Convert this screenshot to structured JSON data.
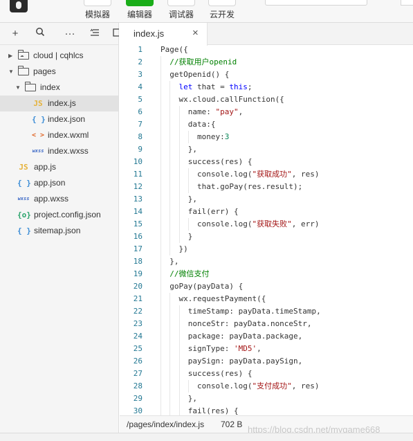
{
  "toolbar": {
    "tools": [
      {
        "label": "模拟器",
        "active": false
      },
      {
        "label": "编辑器",
        "active": true
      },
      {
        "label": "调试器",
        "active": false
      },
      {
        "label": "云开发",
        "active": false
      }
    ],
    "mode_select": "",
    "accent_color": "#1aad19"
  },
  "sidebar": {
    "toolbar_icons": [
      "add-icon",
      "search-icon",
      "more-icon",
      "sort-icon",
      "collapse-icon"
    ],
    "tree": [
      {
        "name": "cloud | cqhlcs",
        "type": "cloud-folder",
        "expanded": false
      },
      {
        "name": "pages",
        "type": "folder",
        "expanded": true
      },
      {
        "name": "index",
        "type": "folder",
        "expanded": true
      },
      {
        "name": "index.js",
        "type": "js",
        "selected": true,
        "icon_text": "JS"
      },
      {
        "name": "index.json",
        "type": "json",
        "icon_text": "{ }"
      },
      {
        "name": "index.wxml",
        "type": "wxml",
        "icon_text": "< >"
      },
      {
        "name": "index.wxss",
        "type": "wxss",
        "icon_text": "wxss"
      },
      {
        "name": "app.js",
        "type": "js",
        "icon_text": "JS"
      },
      {
        "name": "app.json",
        "type": "json",
        "icon_text": "{ }"
      },
      {
        "name": "app.wxss",
        "type": "wxss",
        "icon_text": "wxss"
      },
      {
        "name": "project.config.json",
        "type": "config",
        "icon_text": "{o}"
      },
      {
        "name": "sitemap.json",
        "type": "json",
        "icon_text": "{ }"
      }
    ]
  },
  "editor": {
    "tab": {
      "name": "index.js",
      "close": "×"
    },
    "lines": [
      {
        "n": "1",
        "t": "Page({"
      },
      {
        "n": "2",
        "t": "  //获取用户openid"
      },
      {
        "n": "3",
        "t": "  getOpenid() {"
      },
      {
        "n": "4",
        "t": "    let that = this;"
      },
      {
        "n": "5",
        "t": "    wx.cloud.callFunction({"
      },
      {
        "n": "6",
        "t": "      name: \"pay\","
      },
      {
        "n": "7",
        "t": "      data:{"
      },
      {
        "n": "8",
        "t": "        money:3"
      },
      {
        "n": "9",
        "t": "      },"
      },
      {
        "n": "10",
        "t": "      success(res) {"
      },
      {
        "n": "11",
        "t": "        console.log(\"获取成功\", res)"
      },
      {
        "n": "12",
        "t": "        that.goPay(res.result);"
      },
      {
        "n": "13",
        "t": "      },"
      },
      {
        "n": "14",
        "t": "      fail(err) {"
      },
      {
        "n": "15",
        "t": "        console.log(\"获取失败\", err)"
      },
      {
        "n": "16",
        "t": "      }"
      },
      {
        "n": "17",
        "t": "    })"
      },
      {
        "n": "18",
        "t": "  },"
      },
      {
        "n": "19",
        "t": "  //微信支付"
      },
      {
        "n": "20",
        "t": "  goPay(payData) {"
      },
      {
        "n": "21",
        "t": "    wx.requestPayment({"
      },
      {
        "n": "22",
        "t": "      timeStamp: payData.timeStamp,"
      },
      {
        "n": "23",
        "t": "      nonceStr: payData.nonceStr,"
      },
      {
        "n": "24",
        "t": "      package: payData.package,"
      },
      {
        "n": "25",
        "t": "      signType: 'MD5',"
      },
      {
        "n": "26",
        "t": "      paySign: payData.paySign,"
      },
      {
        "n": "27",
        "t": "      success(res) {"
      },
      {
        "n": "28",
        "t": "        console.log(\"支付成功\", res)"
      },
      {
        "n": "29",
        "t": "      },"
      },
      {
        "n": "30",
        "t": "      fail(res) {"
      }
    ],
    "colors": {
      "keyword": "#0000ff",
      "string": "#a31515",
      "number": "#098658",
      "comment": "#008000",
      "line_number": "#237893"
    }
  },
  "status": {
    "path": "/pages/index/index.js",
    "size": "702 B"
  },
  "watermark": "https://blog.csdn.net/mygame668"
}
